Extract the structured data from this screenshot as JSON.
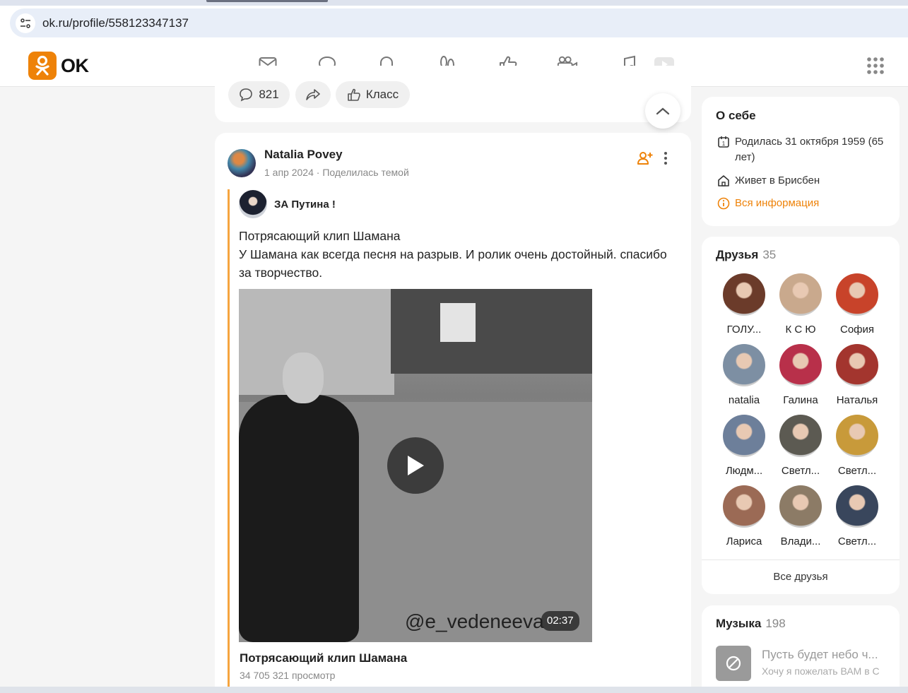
{
  "browser": {
    "url": "ok.ru/profile/558123347137"
  },
  "header": {
    "logo_text": "OK",
    "brand_color": "#ee8208",
    "nav_icons": [
      "mail-icon",
      "discussions-icon",
      "notifications-icon",
      "guests-icon",
      "events-icon",
      "video-icon",
      "music-icon",
      "video-tab-icon"
    ]
  },
  "prev_post": {
    "comments_count": "821",
    "like_label": "Класс"
  },
  "post": {
    "author": "Natalia Povey",
    "date": "1 апр 2024",
    "meta_separator": "·",
    "action": "Поделилась темой",
    "group_name": "ЗА Путина !",
    "text_line1": "Потрясающий клип Шамана",
    "text_line2": "У Шамана как всегда песня на разрыв. И ролик очень достойный. спасибо за творчество.",
    "video": {
      "watermark": "@e_vedeneeva",
      "duration": "02:37",
      "title": "Потрясающий клип Шамана",
      "views": "34 705 321 просмотр"
    }
  },
  "about": {
    "title": "О себе",
    "birthday": "Родилась 31 октября 1959 (65 лет)",
    "location": "Живет в Брисбен",
    "more_info": "Вся информация"
  },
  "friends": {
    "title": "Друзья",
    "count": "35",
    "items": [
      {
        "name": "ГОЛУ...",
        "color": "#6b3b2a"
      },
      {
        "name": "К С Ю",
        "color": "#c9a98d"
      },
      {
        "name": "София",
        "color": "#c8432a"
      },
      {
        "name": "natalia",
        "color": "#7d8fa3"
      },
      {
        "name": "Галина",
        "color": "#b8304a"
      },
      {
        "name": "Наталья",
        "color": "#a3352e"
      },
      {
        "name": "Людм...",
        "color": "#6d7f9a"
      },
      {
        "name": "Светл...",
        "color": "#5c5a52"
      },
      {
        "name": "Светл...",
        "color": "#c89a3a"
      },
      {
        "name": "Лариса",
        "color": "#9b6a55"
      },
      {
        "name": "Влади...",
        "color": "#8c7b66"
      },
      {
        "name": "Светл...",
        "color": "#39465c"
      }
    ],
    "all_label": "Все друзья"
  },
  "music": {
    "title": "Музыка",
    "count": "198",
    "song_title": "Пусть будет небо ч...",
    "song_sub": "Хочу я пожелать ВАМ в С"
  }
}
